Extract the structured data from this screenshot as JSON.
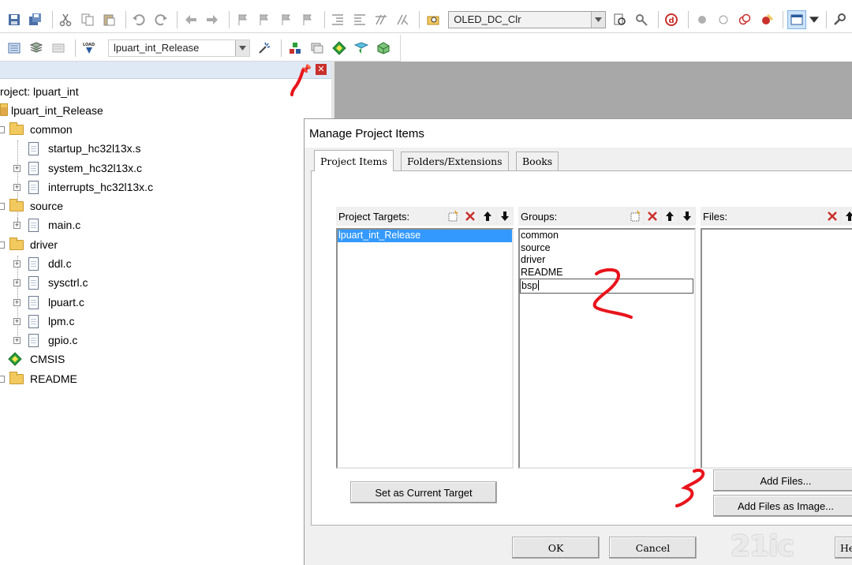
{
  "toolbar1": {
    "find_combo_text": "OLED_DC_Clr"
  },
  "toolbar2": {
    "build_target": "lpuart_int_Release",
    "load_label": "LOAD"
  },
  "project_panel": {
    "root": "roject: lpuart_int",
    "target": "lpuart_int_Release",
    "groups": [
      {
        "name": "common",
        "files": [
          "startup_hc32l13x.s",
          "system_hc32l13x.c",
          "interrupts_hc32l13x.c"
        ]
      },
      {
        "name": "source",
        "files": [
          "main.c"
        ]
      },
      {
        "name": "driver",
        "files": [
          "ddl.c",
          "sysctrl.c",
          "lpuart.c",
          "lpm.c",
          "gpio.c"
        ]
      }
    ],
    "cmsis": "CMSIS",
    "readme": "README"
  },
  "dialog": {
    "title": "Manage Project Items",
    "tabs": [
      "Project Items",
      "Folders/Extensions",
      "Books"
    ],
    "targets_label": "Project Targets:",
    "groups_label": "Groups:",
    "files_label": "Files:",
    "targets": [
      "lpuart_int_Release"
    ],
    "groups": [
      "common",
      "source",
      "driver",
      "README"
    ],
    "group_edit_value": "bsp",
    "set_current_target": "Set as Current Target",
    "add_files": "Add Files...",
    "add_files_image": "Add Files as Image...",
    "ok": "OK",
    "cancel": "Cancel",
    "help": "He"
  },
  "annotations": [
    "1",
    "2",
    "3"
  ],
  "watermark": "21ic",
  "colors": {
    "selection": "#3399ff",
    "panel_title": "#dfe8f5",
    "annotation": "#e8141c",
    "desktop": "#a8a8a8"
  }
}
